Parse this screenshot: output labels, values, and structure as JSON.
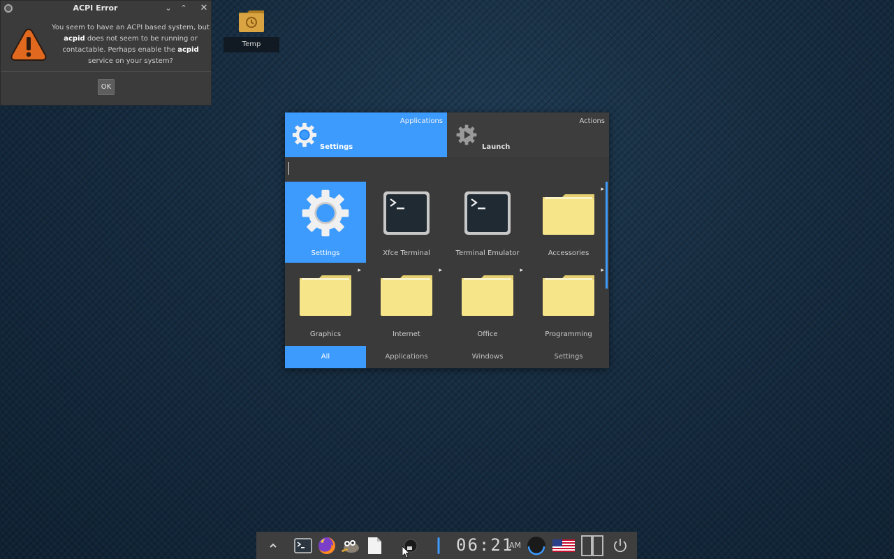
{
  "dialog": {
    "title": "ACPI Error",
    "message_parts": {
      "p1": "You seem to have an ACPI based system, but ",
      "b1": "acpid",
      "p2": " does not seem to be running or contactable. Perhaps enable the ",
      "b2": "acpid",
      "p3": " service on your system?"
    },
    "ok_label": "OK",
    "controls": {
      "minimize": "⌄",
      "maximize": "⌃",
      "close": "✕"
    }
  },
  "desktop": {
    "icons": [
      {
        "label": "Temp",
        "icon": "folder-clock-icon"
      }
    ]
  },
  "menu": {
    "tabs": [
      {
        "label": "Settings",
        "corner": "Applications",
        "icon": "settings-gear-icon",
        "active": true
      },
      {
        "label": "Launch",
        "corner": "Actions",
        "icon": "launch-gear-icon",
        "active": false
      }
    ],
    "search": {
      "value": "",
      "placeholder": ""
    },
    "items": [
      {
        "label": "Settings",
        "icon": "settings-gear-icon",
        "submenu": false,
        "active": true
      },
      {
        "label": "Xfce Terminal",
        "icon": "terminal-icon",
        "submenu": false,
        "active": false
      },
      {
        "label": "Terminal Emulator",
        "icon": "terminal-icon",
        "submenu": false,
        "active": false
      },
      {
        "label": "Accessories",
        "icon": "folder-icon",
        "submenu": true,
        "active": false
      },
      {
        "label": "Graphics",
        "icon": "folder-icon",
        "submenu": true,
        "active": false
      },
      {
        "label": "Internet",
        "icon": "folder-icon",
        "submenu": true,
        "active": false
      },
      {
        "label": "Office",
        "icon": "folder-icon",
        "submenu": true,
        "active": false
      },
      {
        "label": "Programming",
        "icon": "folder-icon",
        "submenu": true,
        "active": false
      }
    ],
    "filters": [
      {
        "label": "All",
        "active": true
      },
      {
        "label": "Applications",
        "active": false
      },
      {
        "label": "Windows",
        "active": false
      },
      {
        "label": "Settings",
        "active": false
      }
    ]
  },
  "panel": {
    "clock": "06:21",
    "ampm": "AM",
    "items": [
      "show-hidden-icon",
      "terminal-icon",
      "firefox-icon",
      "gimp-icon",
      "text-editor-icon",
      "sleep-monitor-icon",
      "volume-icon",
      "network-icon",
      "us-flag-icon",
      "workspaces-icon",
      "power-icon"
    ]
  },
  "colors": {
    "accent": "#3d9bfd",
    "menu_bg": "#3a3a3a",
    "dialog_bg": "#3b3b3b",
    "warning": "#e0691f",
    "folder": "#f7e589",
    "panel_bg": "#3e3e3e"
  }
}
